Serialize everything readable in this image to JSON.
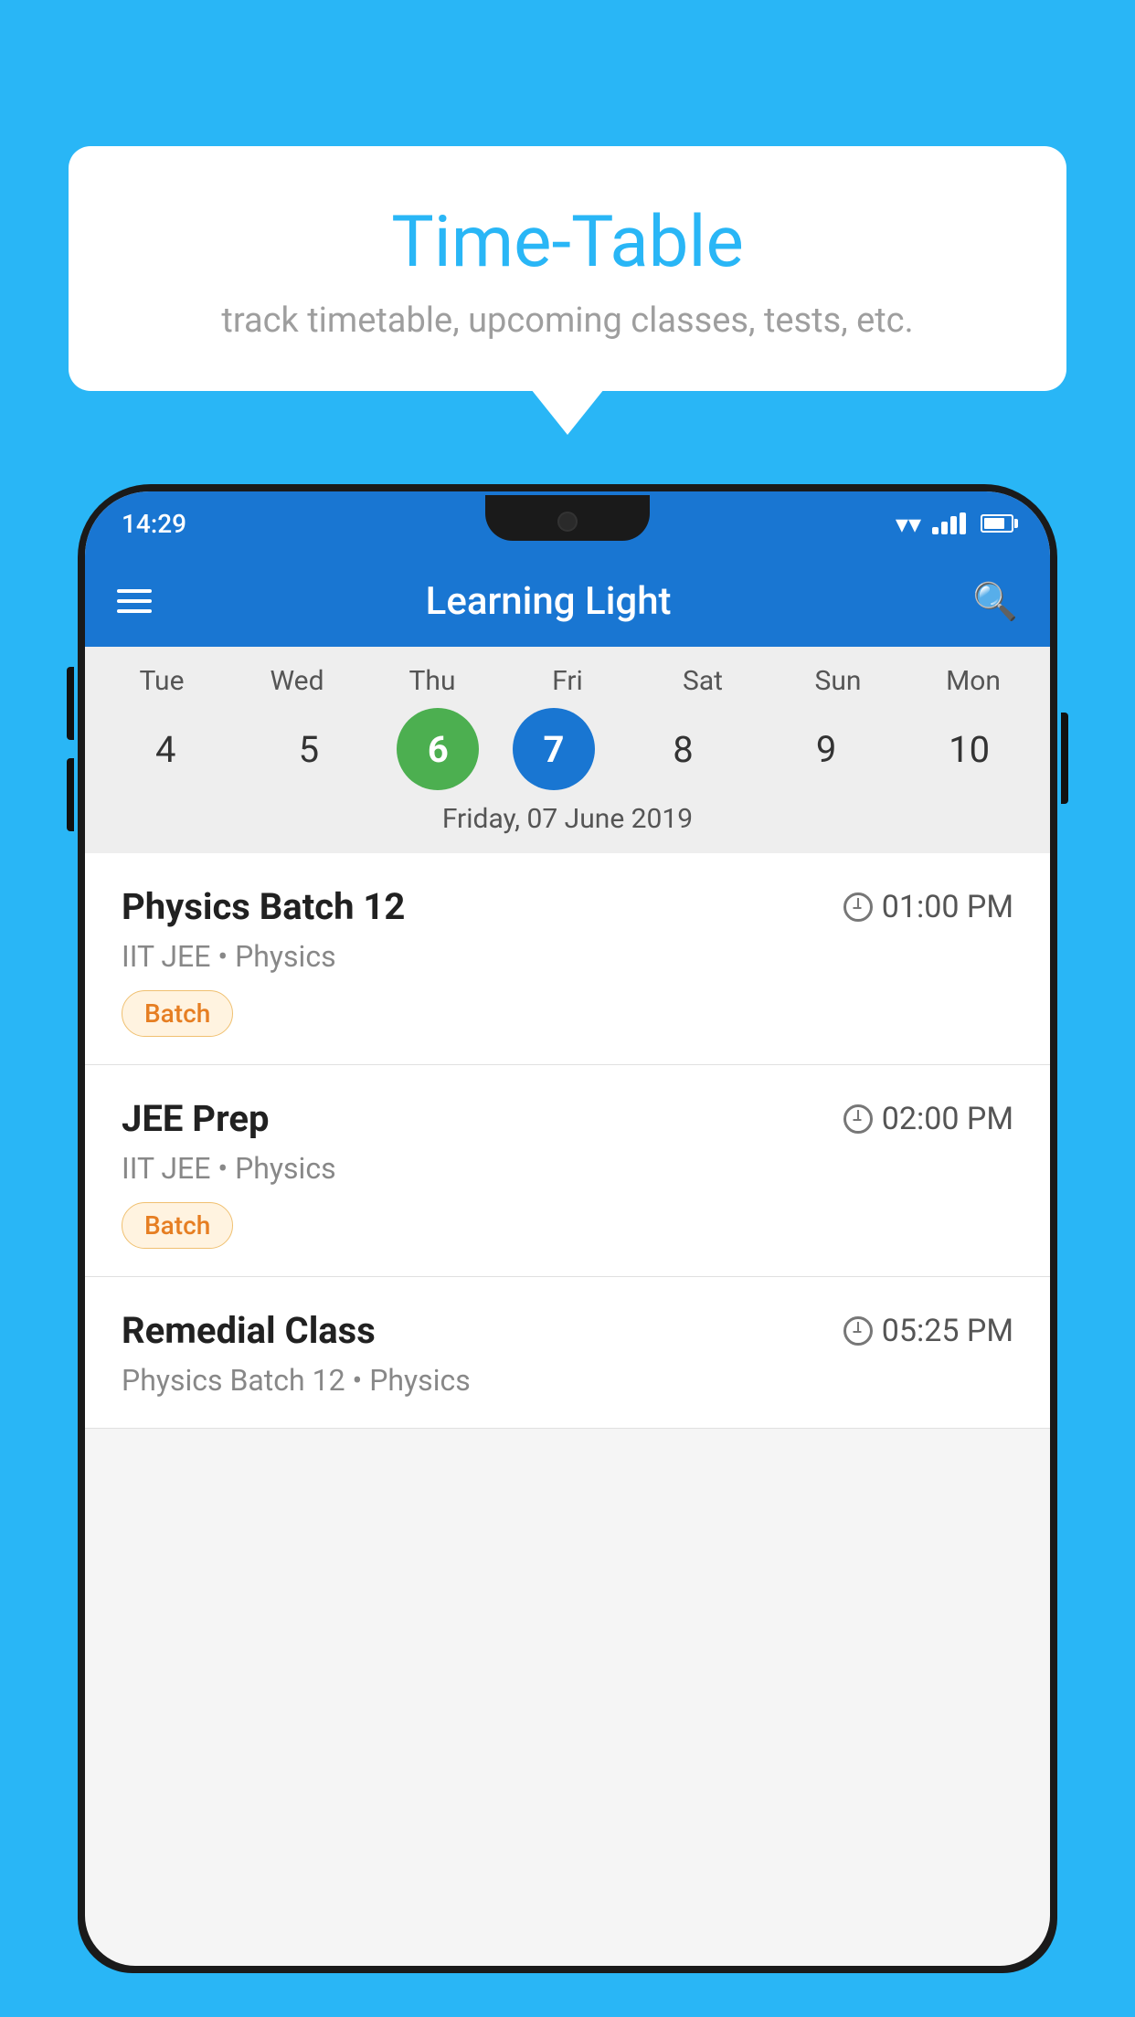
{
  "background_color": "#29b6f6",
  "bubble": {
    "title": "Time-Table",
    "subtitle": "track timetable, upcoming classes, tests, etc."
  },
  "app": {
    "hamburger_label": "menu",
    "title": "Learning Light",
    "search_label": "search"
  },
  "status_bar": {
    "time": "14:29"
  },
  "calendar": {
    "days": [
      {
        "name": "Tue",
        "num": "4",
        "state": "normal"
      },
      {
        "name": "Wed",
        "num": "5",
        "state": "normal"
      },
      {
        "name": "Thu",
        "num": "6",
        "state": "today"
      },
      {
        "name": "Fri",
        "num": "7",
        "state": "selected"
      },
      {
        "name": "Sat",
        "num": "8",
        "state": "normal"
      },
      {
        "name": "Sun",
        "num": "9",
        "state": "normal"
      },
      {
        "name": "Mon",
        "num": "10",
        "state": "normal"
      }
    ],
    "selected_date_label": "Friday, 07 June 2019"
  },
  "schedule": {
    "items": [
      {
        "title": "Physics Batch 12",
        "time": "01:00 PM",
        "subtitle": "IIT JEE • Physics",
        "tag": "Batch"
      },
      {
        "title": "JEE Prep",
        "time": "02:00 PM",
        "subtitle": "IIT JEE • Physics",
        "tag": "Batch"
      },
      {
        "title": "Remedial Class",
        "time": "05:25 PM",
        "subtitle": "Physics Batch 12 • Physics",
        "tag": ""
      }
    ]
  }
}
